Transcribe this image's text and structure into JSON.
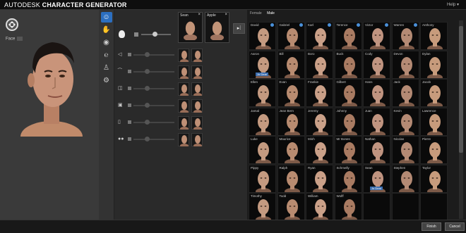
{
  "header": {
    "brand": "AUTODESK",
    "product": "CHARACTER GENERATOR",
    "help": "Help"
  },
  "viewport": {
    "view_select": "Face"
  },
  "toolstrip": {
    "icons": [
      "head-icon",
      "body-icon",
      "eye-icon",
      "ear-icon",
      "figure-icon",
      "hand-icon"
    ]
  },
  "blend": {
    "presets": [
      {
        "name": "Sean"
      },
      {
        "name": "Apple"
      }
    ],
    "transfer_icon": "transfer-icon",
    "rows": [
      {
        "icon": "nose-icon"
      },
      {
        "icon": "eyebrow-icon"
      },
      {
        "icon": "mouth-icon"
      },
      {
        "icon": "chin-icon"
      },
      {
        "icon": "jaw-icon"
      },
      {
        "icon": "eyes-icon"
      }
    ]
  },
  "gender_tabs": [
    "Female",
    "Male"
  ],
  "characters": [
    [
      "David",
      "Gabriel",
      "Karl",
      "Terence",
      "Victor",
      "Warren",
      "Anthony"
    ],
    [
      "Aaron",
      "Bill",
      "Boro",
      "Buck",
      "Cody",
      "Devon",
      "Dylan"
    ],
    [
      "Ellen",
      "Evan",
      "Frankie",
      "Gilbert",
      "Hans",
      "Jack",
      "Jacob"
    ],
    [
      "Jamal",
      "Jean Bern",
      "Jeremy",
      "Johnny",
      "Juan",
      "Kevin",
      "Lawrence"
    ],
    [
      "Luke",
      "Maurice",
      "Minh",
      "Mr Bones",
      "Nathan",
      "Nicolas",
      "Pierre"
    ],
    [
      "Pippy",
      "Ralph",
      "Ryan",
      "Schmelly",
      "Sean",
      "Stephen",
      "Taylor"
    ],
    [
      "Timothy",
      "Todd",
      "William",
      "Wolff",
      "",
      "",
      ""
    ]
  ],
  "selected_markers": {
    "top_row": [
      0,
      1,
      2,
      3,
      4,
      5
    ],
    "tag_text": "Jo Dear"
  },
  "footer": {
    "finish": "Finish",
    "cancel": "Cancel"
  }
}
